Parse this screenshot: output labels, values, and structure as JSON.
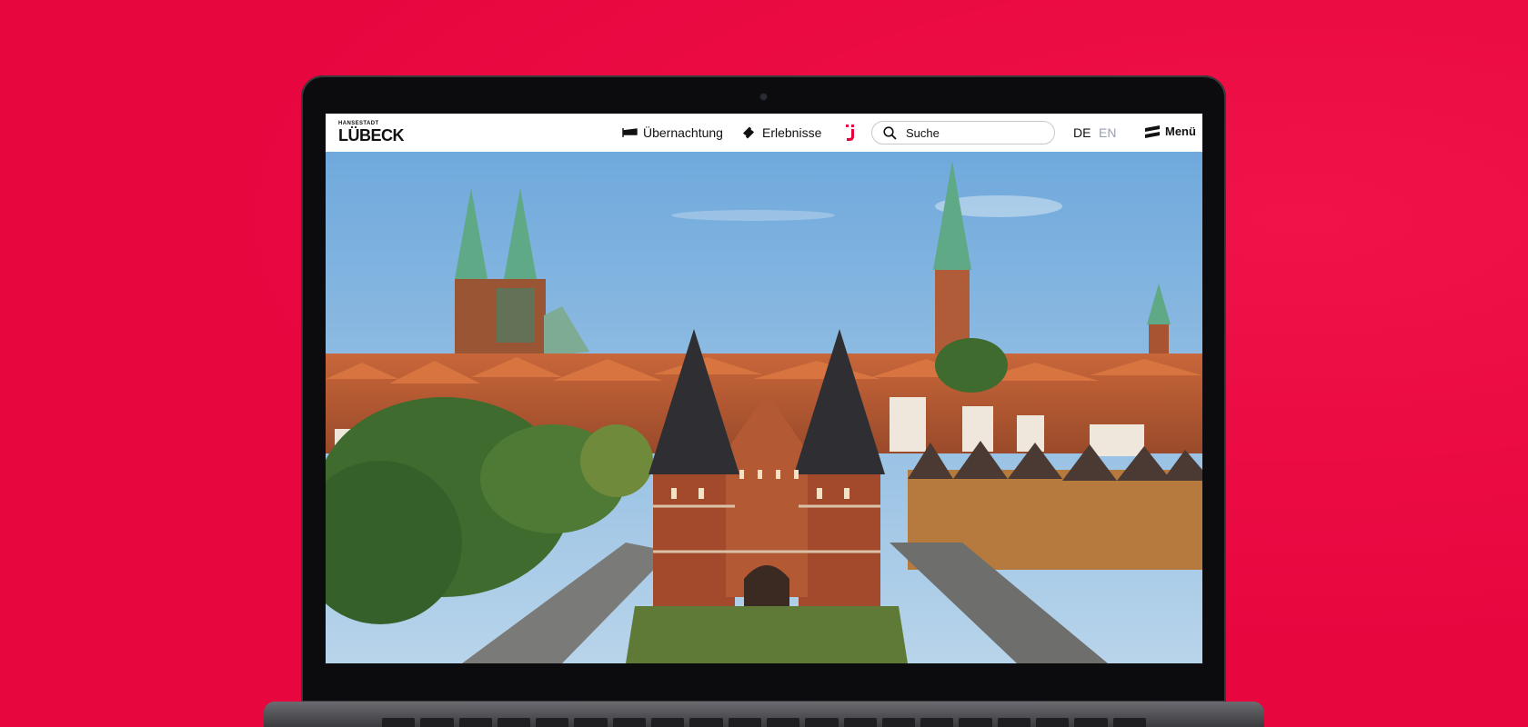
{
  "site": {
    "logo_small": "HANSESTADT",
    "logo_big": "LÜBECK"
  },
  "nav": {
    "overnight": "Übernachtung",
    "experiences": "Erlebnisse"
  },
  "search": {
    "placeholder": "Suche"
  },
  "languages": {
    "de": "DE",
    "en": "EN"
  },
  "menu": {
    "label": "Menü"
  },
  "colors": {
    "background": "#e8063f",
    "brand_red": "#e4003c",
    "header_bg": "#ffffff",
    "lang_inactive": "#9aa0b4"
  },
  "icons": {
    "overnight": "bed-flag-icon",
    "experiences": "ticket-icon",
    "brand": "luebeck-mark-icon",
    "search": "search-icon",
    "menu": "hamburger-icon"
  }
}
